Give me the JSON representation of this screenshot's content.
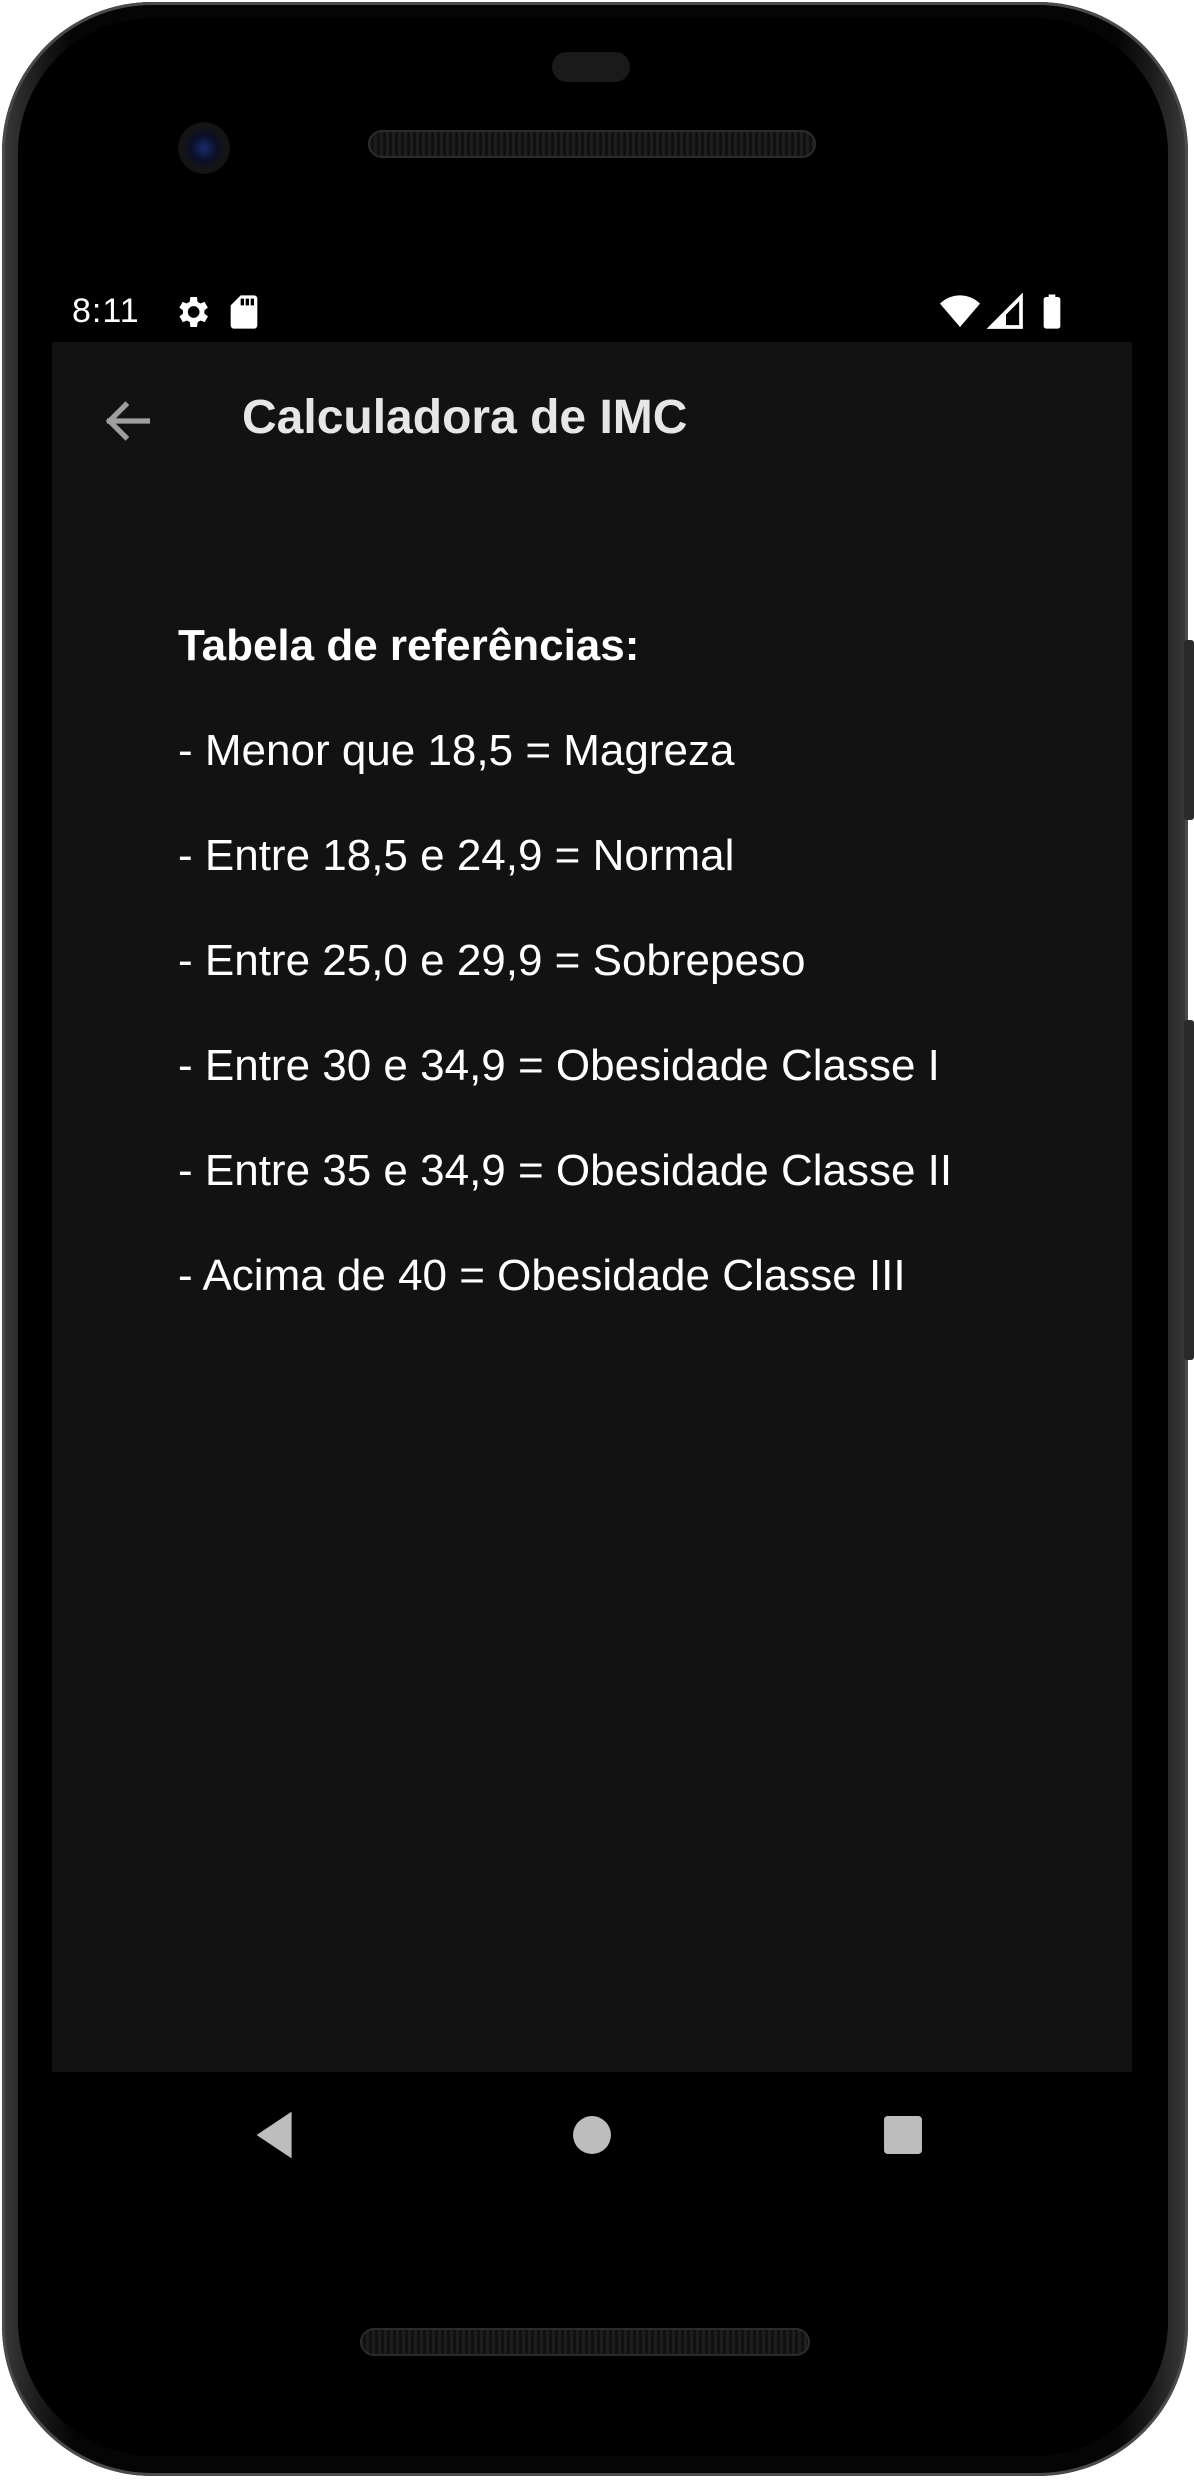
{
  "status_bar": {
    "time": "8:11",
    "left_icons": [
      "settings-gear-icon",
      "sd-card-icon"
    ],
    "right_icons": [
      "wifi-icon",
      "cell-signal-icon",
      "battery-icon"
    ]
  },
  "app_bar": {
    "title": "Calculadora de IMC",
    "back_icon": "arrow-back-icon"
  },
  "content": {
    "heading": "Tabela de referências:",
    "items": [
      "- Menor que 18,5 = Magreza",
      "- Entre 18,5 e 24,9 = Normal",
      "- Entre 25,0 e 29,9 = Sobrepeso",
      "- Entre 30 e 34,9 = Obesidade Classe I",
      "- Entre 35 e 34,9 = Obesidade Classe II",
      "- Acima de 40 = Obesidade Classe III"
    ]
  },
  "nav_bar": {
    "buttons": [
      "back-triangle-icon",
      "home-circle-icon",
      "recents-square-icon"
    ]
  },
  "colors": {
    "screen_background": "#121212",
    "text": "#ffffff",
    "title_text": "#e6e6e6",
    "back_arrow": "#9e9e9e",
    "nav_icons": "#bdbdbd"
  }
}
